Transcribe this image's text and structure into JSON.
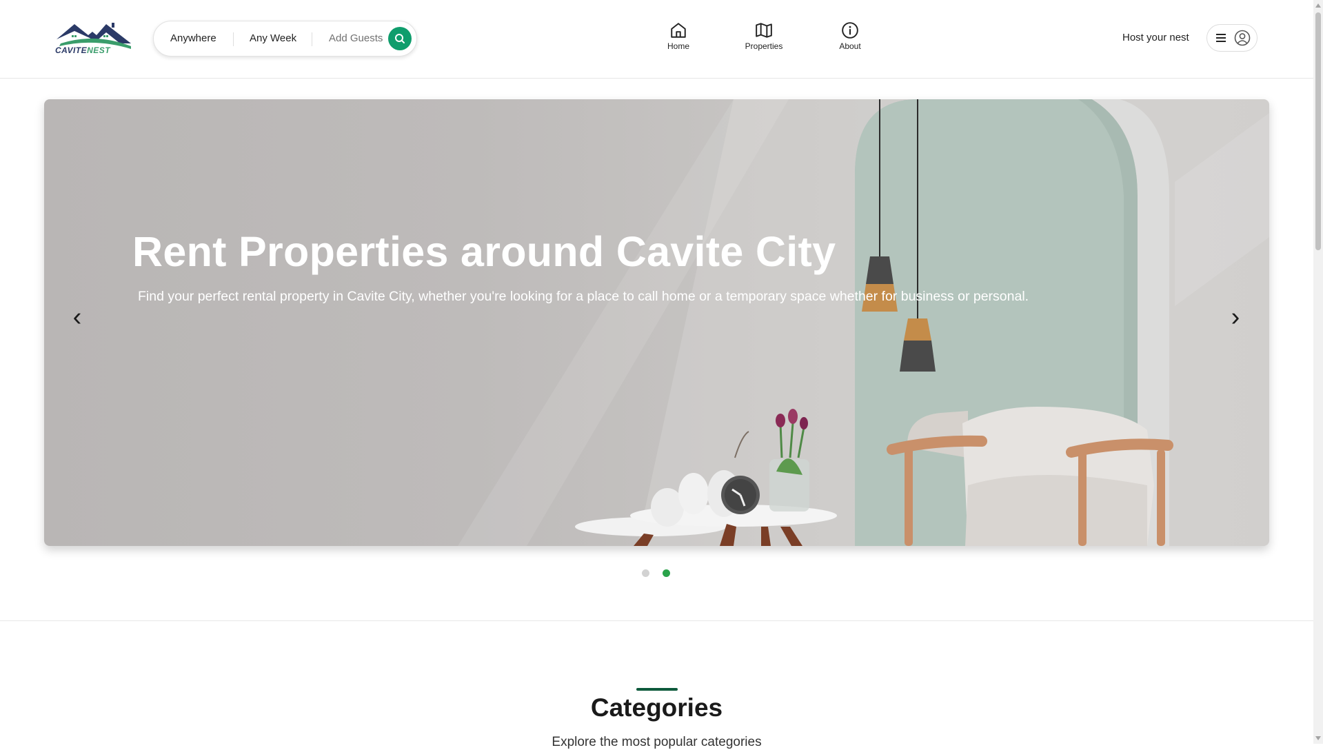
{
  "brand": {
    "logo_text_part1": "CAVITE",
    "logo_text_part2": "NEST",
    "accent_color": "#0f9d6c",
    "logo_navy": "#2b3a67",
    "logo_green": "#3a9d6b"
  },
  "search": {
    "location_label": "Anywhere",
    "week_label": "Any Week",
    "guests_label": "Add Guests",
    "icon": "search-icon"
  },
  "nav": {
    "items": [
      {
        "label": "Home",
        "icon": "home-icon"
      },
      {
        "label": "Properties",
        "icon": "map-icon"
      },
      {
        "label": "About",
        "icon": "info-icon"
      }
    ]
  },
  "header_right": {
    "host_label": "Host your nest",
    "menu_icon": "hamburger-icon",
    "avatar_icon": "user-avatar-icon"
  },
  "hero": {
    "title": "Rent Properties around Cavite City",
    "subtitle": "Find your perfect rental property in Cavite City, whether you're looking for a place to call home or a temporary space whether for business or personal.",
    "prev_arrow": "‹",
    "next_arrow": "›",
    "slide_count": 2,
    "active_slide": 2,
    "active_dot_color": "#2aa34a"
  },
  "categories": {
    "title": "Categories",
    "subtitle": "Explore the most popular categories"
  }
}
